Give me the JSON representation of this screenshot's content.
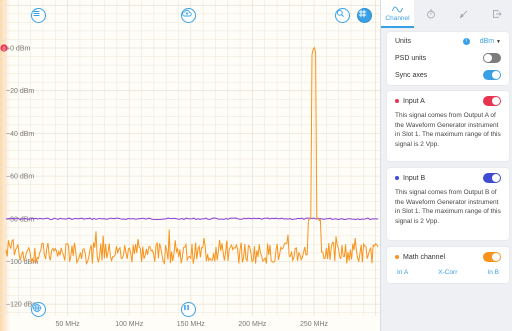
{
  "plot": {
    "y_axis": {
      "unit": "dBm",
      "ticks": [
        "+0 dBm",
        "−20 dBm",
        "−40 dBm",
        "−60 dBm",
        "−80 dBm",
        "−100 dBm",
        "−120 dBm"
      ]
    },
    "x_axis": {
      "ticks": [
        "50 MHz",
        "100 MHz",
        "150 MHz",
        "200 MHz",
        "250 MHz"
      ]
    },
    "marker_label": "0",
    "colors": {
      "input_a": "#f7941d",
      "input_b": "#8b3fd6",
      "grid": "#ece5d6",
      "accent": "#3aa0e6"
    },
    "traces": {
      "input_a": {
        "name": "Input A",
        "noise_floor_dbm": -96,
        "peak": {
          "freq_mhz": 250,
          "dbm": 1
        }
      },
      "input_b": {
        "name": "Input B",
        "level_dbm": -80
      }
    },
    "buttons": {
      "menu_icon": "menu-icon",
      "cloud_icon": "cloud-icon",
      "zoom_icon": "zoom-icon",
      "cursor_icon": "crosshair-icon",
      "autoscale_icon": "autoscale-icon",
      "pause_icon": "pause-icon"
    }
  },
  "tabs": [
    {
      "name": "channel",
      "label": "Channel",
      "icon": "wave-icon",
      "active": true
    },
    {
      "name": "timebase",
      "label": "",
      "icon": "stopwatch-icon",
      "active": false
    },
    {
      "name": "measure",
      "label": "",
      "icon": "ruler-icon",
      "active": false
    },
    {
      "name": "export",
      "label": "",
      "icon": "exit-icon",
      "active": false
    }
  ],
  "settings": {
    "units_label": "Units",
    "units_value": "dBm",
    "psd_label": "PSD units",
    "psd_on": false,
    "sync_label": "Sync axes",
    "sync_on": true
  },
  "channels": [
    {
      "name": "Input A",
      "enabled": true,
      "description": "This signal comes from Output A of the Waveform Generator instrument in Slot 1. The maximum range of this signal is 2 Vpp.",
      "color": "#e8344e"
    },
    {
      "name": "Input B",
      "enabled": true,
      "description": "This signal comes from Output B of the Waveform Generator instrument in Slot 1. The maximum range of this signal is 2 Vpp.",
      "color": "#3f4bd0"
    }
  ],
  "math": {
    "name": "Math channel",
    "enabled": true,
    "color": "#f7941d",
    "in_a": "In A",
    "op": "X-Corr",
    "in_b": "In B"
  }
}
